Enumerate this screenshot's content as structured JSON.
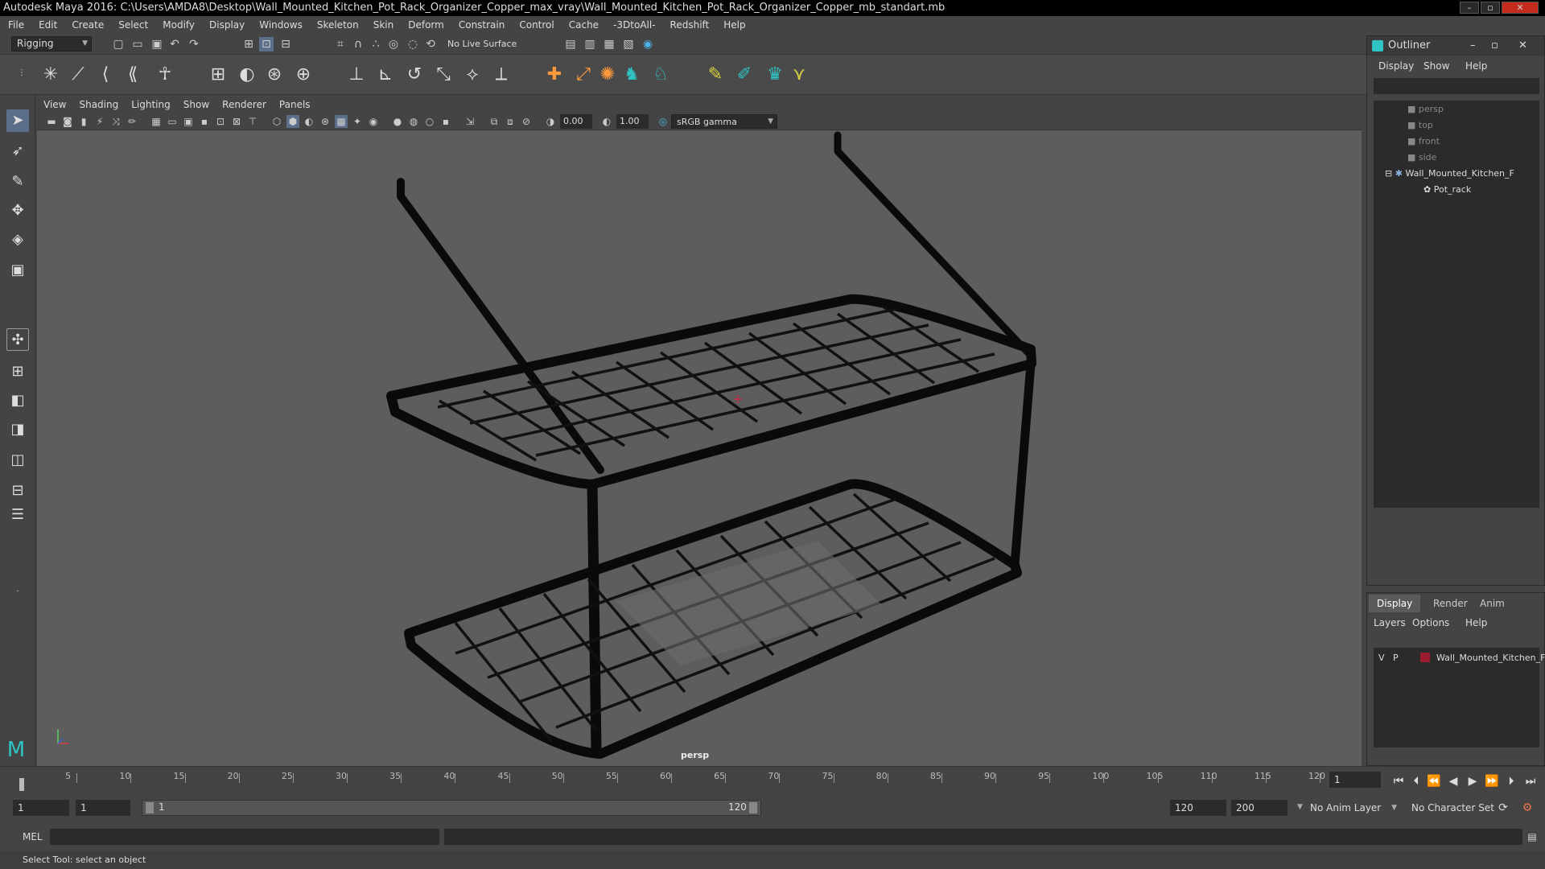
{
  "window": {
    "title": "Autodesk Maya 2016: C:\\Users\\AMDA8\\Desktop\\Wall_Mounted_Kitchen_Pot_Rack_Organizer_Copper_max_vray\\Wall_Mounted_Kitchen_Pot_Rack_Organizer_Copper_mb_standart.mb",
    "minimize_icon": "minimize-icon",
    "maximize_icon": "maximize-icon",
    "close_icon": "close-icon"
  },
  "menubar": [
    "File",
    "Edit",
    "Create",
    "Select",
    "Modify",
    "Display",
    "Windows",
    "Skeleton",
    "Skin",
    "Deform",
    "Constrain",
    "Control",
    "Cache",
    "-3DtoAll-",
    "Redshift",
    "Help"
  ],
  "statusline": {
    "mode": "Rigging",
    "live_surface": "No Live Surface"
  },
  "panel": {
    "menu": [
      "View",
      "Shading",
      "Lighting",
      "Show",
      "Renderer",
      "Panels"
    ],
    "near_value": "0.00",
    "far_value": "1.00",
    "color_space": "sRGB gamma",
    "camera_label": "persp"
  },
  "outliner": {
    "title": "Outliner",
    "menu": [
      "Display",
      "Show",
      "Help"
    ],
    "items": [
      {
        "label": "persp",
        "dim": true
      },
      {
        "label": "top",
        "dim": true
      },
      {
        "label": "front",
        "dim": true
      },
      {
        "label": "side",
        "dim": true
      },
      {
        "label": "Wall_Mounted_Kitchen_F",
        "dim": false
      },
      {
        "label": "Pot_rack",
        "dim": false
      }
    ]
  },
  "channel_box": {
    "tabs": [
      "Display",
      "Render",
      "Anim"
    ],
    "menu": [
      "Layers",
      "Options",
      "Help"
    ],
    "layer": {
      "v": "V",
      "p": "P",
      "name": "Wall_Mounted_Kitchen_F",
      "color": "#9b1b30"
    }
  },
  "timeline": {
    "ticks": [
      "5",
      "10",
      "15",
      "20",
      "25",
      "30",
      "35",
      "40",
      "45",
      "50",
      "55",
      "60",
      "65",
      "70",
      "75",
      "80",
      "85",
      "90",
      "95",
      "100",
      "105",
      "110",
      "115",
      "120"
    ],
    "current_frame": "1",
    "current_field": "1"
  },
  "range": {
    "start_a": "1",
    "start_b": "1",
    "slider_start": "1",
    "slider_end": "120",
    "end_a": "120",
    "end_b": "200",
    "anim_layer": "No Anim Layer",
    "character_set": "No Character Set"
  },
  "command": {
    "label": "MEL"
  },
  "help_line": "Select Tool: select an object"
}
